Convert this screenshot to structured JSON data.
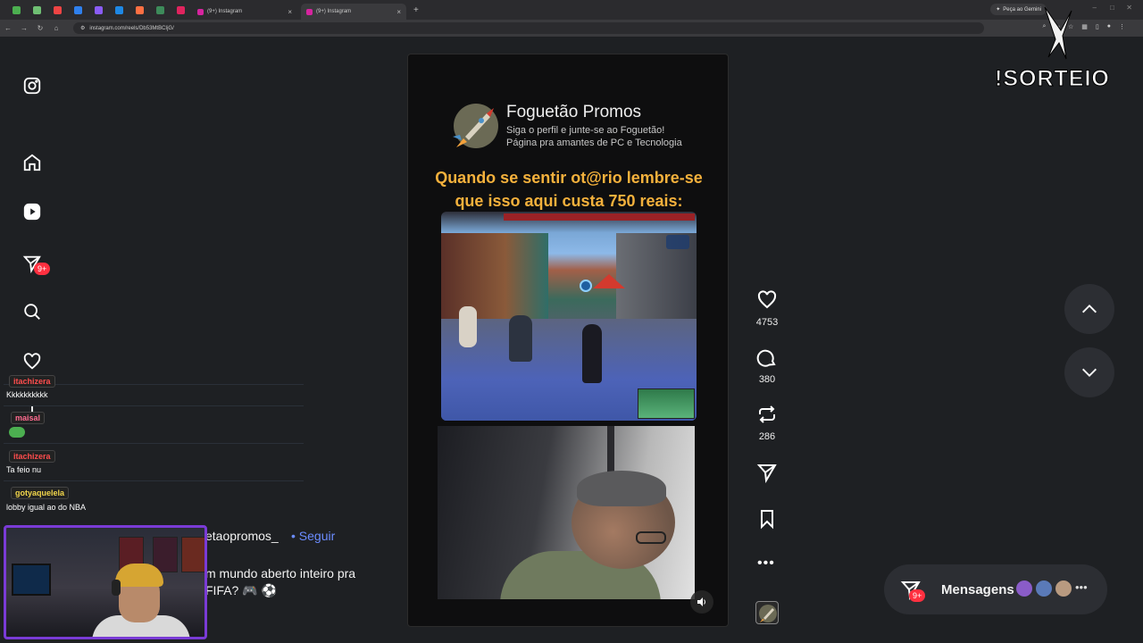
{
  "browser": {
    "tabs": [
      {
        "title": "(9+) Instagram",
        "active": false
      },
      {
        "title": "(9+) Instagram",
        "active": true
      }
    ],
    "gemini_label": "Peça ao Gemini",
    "url": "instagram.com/reels/Db53MtBCIjG/"
  },
  "sidebar": {
    "badge": "9+"
  },
  "chat": {
    "messages": [
      {
        "user": "itachizera",
        "user_color": "#ff4d4d",
        "text": "Kkkkkkkkkk"
      },
      {
        "user": "maisal",
        "user_color": "#ff6b8f",
        "text": ""
      },
      {
        "user": "itachizera",
        "user_color": "#ff4d4d",
        "text": "Ta feio nu"
      },
      {
        "user": "gotyaquelela",
        "user_color": "#f2d64b",
        "text": "lobby igual ao do NBA"
      }
    ]
  },
  "caption": {
    "username": "etaopromos_",
    "follow": "• Seguir",
    "line1": "m mundo aberto inteiro pra",
    "line2": "FIFA? 🎮 ⚽"
  },
  "reel": {
    "brand_name": "Foguetão Promos",
    "brand_sub1": "Siga o perfil e junte-se ao Foguetão!",
    "brand_sub2": "Página pra amantes de PC e Tecnologia",
    "headline1": "Quando se sentir ot@rio lembre-se",
    "headline2": "que isso aqui custa 750 reais:"
  },
  "actions": {
    "likes": "4753",
    "comments": "380",
    "reposts": "286"
  },
  "messages": {
    "label": "Mensagens",
    "badge": "9+"
  },
  "overlay": {
    "sorteio": "!SORTEIO"
  },
  "colors": {
    "accent_badge": "#ff3040",
    "headline": "#f4b13c",
    "follow_link": "#6b8cff",
    "webcam_border": "#7a3bd6"
  }
}
